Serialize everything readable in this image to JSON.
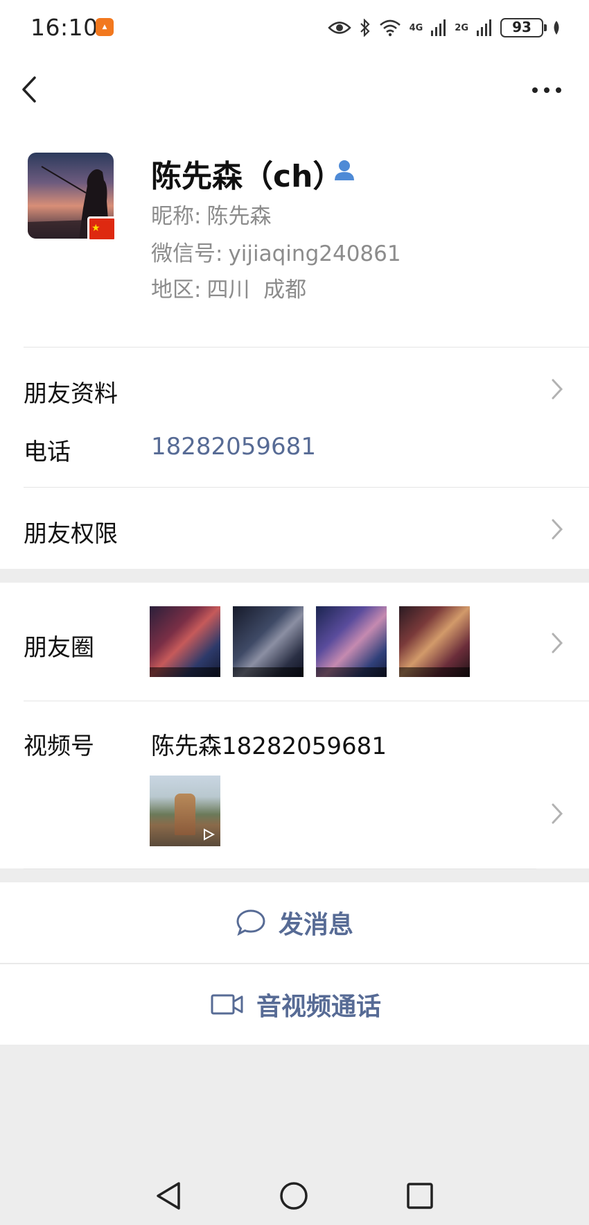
{
  "status_bar": {
    "time": "16:10",
    "battery": "93",
    "signal_1": "4G",
    "signal_2": "2G"
  },
  "profile": {
    "remark_name": "陈先森（ch）",
    "nickname_label": "昵称:",
    "nickname": "陈先森",
    "wechat_id_label": "微信号:",
    "wechat_id": "yijiaqing240861",
    "region_label": "地区:",
    "region": "四川  成都"
  },
  "rows": {
    "friend_info": "朋友资料",
    "phone_label": "电话",
    "phone": "18282059681",
    "permissions": "朋友权限",
    "moments": "朋友圈",
    "channels_label": "视频号",
    "channels_name": "陈先森18282059681"
  },
  "actions": {
    "message": "发消息",
    "call": "音视频通话"
  },
  "colors": {
    "link_blue": "#576b95",
    "background": "#ededed",
    "card": "#ffffff"
  },
  "icons": {
    "back": "chevron-left-icon",
    "more": "more-dots-icon",
    "contact": "person-icon",
    "chevron": "chevron-right-icon",
    "message": "chat-bubble-icon",
    "call": "video-camera-icon"
  }
}
